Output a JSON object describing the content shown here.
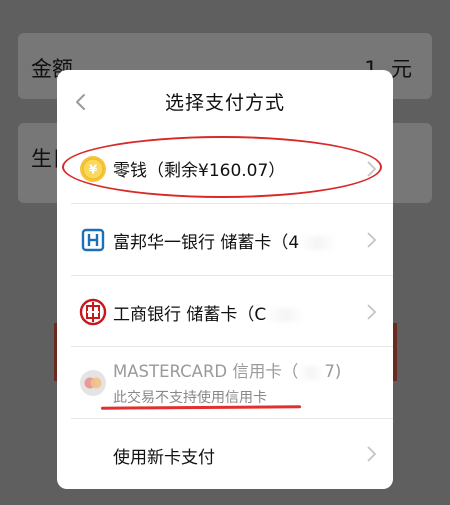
{
  "background": {
    "amount_label": "金额",
    "amount_value": "1",
    "amount_unit": "元",
    "birth_label": "生日"
  },
  "dialog": {
    "title": "选择支付方式",
    "options": [
      {
        "label": "零钱（剩余¥160.07）",
        "icon": "coin-icon"
      },
      {
        "label": "富邦华一银行 储蓄卡（4",
        "icon": "fubon-bank-icon"
      },
      {
        "label": "工商银行 储蓄卡（C",
        "icon": "icbc-bank-icon"
      },
      {
        "label": "MASTERCARD 信用卡（",
        "label_tail": "7)",
        "sublabel": "此交易不支持使用信用卡",
        "icon": "mastercard-icon",
        "disabled": true
      },
      {
        "label": "使用新卡支付"
      }
    ]
  },
  "colors": {
    "annotation": "#d82828",
    "overlay": "#5f5f5f",
    "disabled_text": "#9a9a9a"
  }
}
